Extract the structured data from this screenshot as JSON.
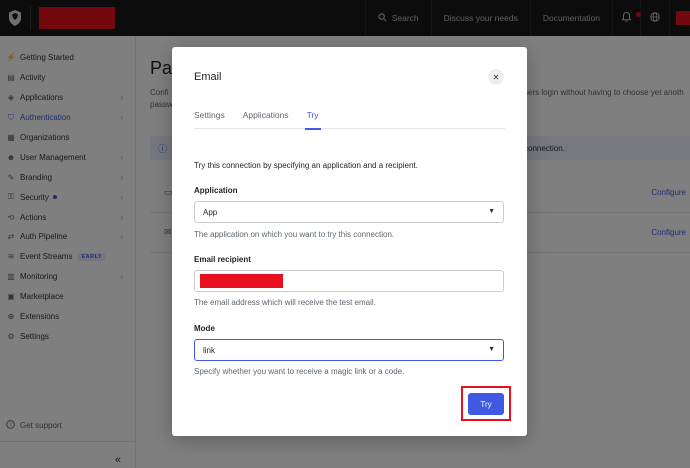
{
  "topbar": {
    "search_label": "Search",
    "discuss_label": "Discuss your needs",
    "docs_label": "Documentation"
  },
  "sidebar": {
    "items": [
      {
        "label": "Getting Started",
        "icon": "bolt-icon"
      },
      {
        "label": "Activity",
        "icon": "activity-icon"
      },
      {
        "label": "Applications",
        "icon": "layers-icon",
        "chevron": true
      },
      {
        "label": "Authentication",
        "icon": "shield-check-icon",
        "chevron": true,
        "active": true
      },
      {
        "label": "Organizations",
        "icon": "grid-icon"
      },
      {
        "label": "User Management",
        "icon": "users-icon",
        "chevron": true
      },
      {
        "label": "Branding",
        "icon": "brush-icon",
        "chevron": true
      },
      {
        "label": "Security",
        "icon": "lock-icon",
        "chevron": true,
        "dot": true
      },
      {
        "label": "Actions",
        "icon": "actions-icon",
        "chevron": true
      },
      {
        "label": "Auth Pipeline",
        "icon": "pipeline-icon",
        "chevron": true
      },
      {
        "label": "Event Streams",
        "icon": "stream-icon",
        "badge": "EARLY"
      },
      {
        "label": "Monitoring",
        "icon": "monitor-icon",
        "chevron": true
      },
      {
        "label": "Marketplace",
        "icon": "marketplace-icon"
      },
      {
        "label": "Extensions",
        "icon": "extensions-icon"
      },
      {
        "label": "Settings",
        "icon": "gear-icon"
      }
    ],
    "support_label": "Get support",
    "collapse_glyph": "«"
  },
  "page": {
    "title": "Pa",
    "desc_line1": "Confi",
    "desc_line2": "passw",
    "desc_right": "sers login without having to choose yet anoth",
    "banner_text": "connection.",
    "configure_label": "Configure"
  },
  "modal": {
    "title": "Email",
    "tabs": [
      "Settings",
      "Applications",
      "Try"
    ],
    "active_tab": "Try",
    "intro": "Try this connection by specifying an application and a recipient.",
    "application": {
      "label": "Application",
      "value": "App",
      "help": "The application on which you want to try this connection."
    },
    "email": {
      "label": "Email recipient",
      "help": "The email address which will receive the test email."
    },
    "mode": {
      "label": "Mode",
      "value": "link",
      "help": "Specify whether you want to receive a magic link or a code."
    },
    "try_label": "Try"
  },
  "colors": {
    "accent": "#3f59e4",
    "redaction": "#e8101e",
    "topbar": "#191919"
  }
}
